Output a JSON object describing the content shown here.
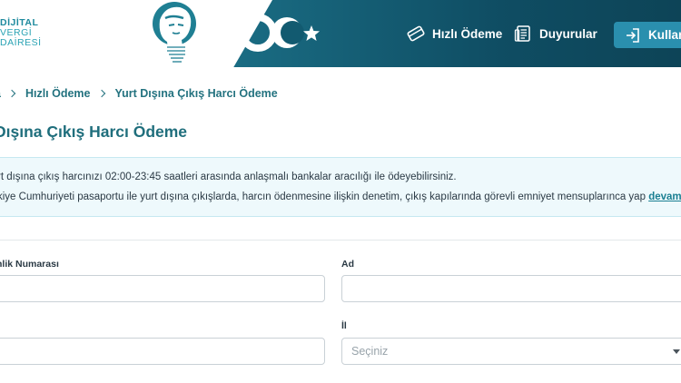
{
  "logo": {
    "line1": "DİJİTAL",
    "line2": "VERGİ",
    "line3": "DAİRESİ"
  },
  "nav": {
    "quick_pay": "Hızlı Ödeme",
    "news": "Duyurular",
    "login": "Kullanıcı"
  },
  "breadcrumb": {
    "home": "a",
    "quick_pay": "Hızlı Ödeme",
    "current": "Yurt Dışına Çıkış Harcı Ödeme"
  },
  "page_title": "Dışına Çıkış Harcı Ödeme",
  "info": {
    "line1": "rt dışına çıkış harcınızı 02:00-23:45 saatleri arasında anlaşmalı bankalar aracılığı ile ödeyebilirsiniz.",
    "line2": "kiye Cumhuriyeti pasaportu ile yurt dışına çıkışlarda, harcın ödenmesine ilişkin denetim, çıkış kapılarında görevli emniyet mensuplarınca yap",
    "more_link": "devamını o"
  },
  "form": {
    "id_label": "nlik Numarası",
    "name_label": "Ad",
    "province_label": "İl",
    "province_placeholder": "Seçiniz"
  },
  "colors": {
    "header_band": "#0f4d63",
    "accent": "#1f6e7c",
    "login_button": "#2a8fae",
    "info_bg": "#eef9fc"
  }
}
